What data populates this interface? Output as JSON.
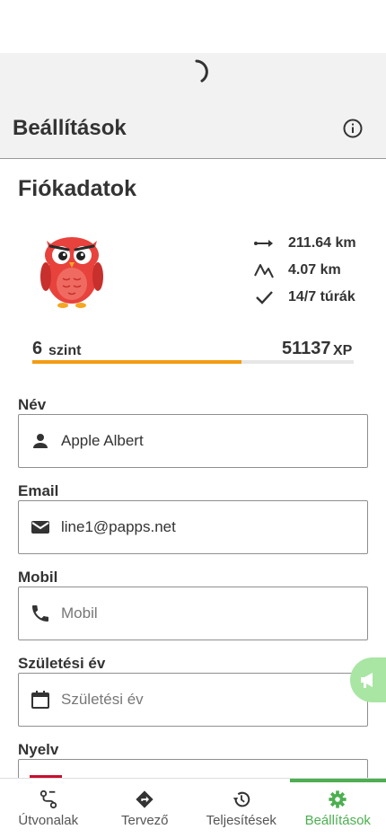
{
  "header": {
    "title": "Beállítások"
  },
  "account": {
    "section_title": "Fiókadatok",
    "stats": [
      {
        "icon": "distance-icon",
        "text": "211.64 km"
      },
      {
        "icon": "elevation-icon",
        "text": "4.07 km"
      },
      {
        "icon": "check-icon",
        "text": "14/7 túrák"
      }
    ],
    "level": {
      "value": "6",
      "unit": "szint"
    },
    "xp": {
      "value": "51137",
      "unit": "XP",
      "progress_fraction": 0.65
    }
  },
  "form": {
    "name": {
      "label": "Név",
      "value": "Apple Albert"
    },
    "email": {
      "label": "Email",
      "value": "line1@papps.net"
    },
    "mobile": {
      "label": "Mobil",
      "placeholder": "Mobil"
    },
    "birth_year": {
      "label": "Születési év",
      "placeholder": "Születési év"
    },
    "language": {
      "label": "Nyelv"
    }
  },
  "tabs": [
    {
      "label": "Útvonalak",
      "icon": "route-icon"
    },
    {
      "label": "Tervező",
      "icon": "directions-icon"
    },
    {
      "label": "Teljesítések",
      "icon": "history-icon"
    },
    {
      "label": "Beállítások",
      "icon": "gear-icon",
      "active": true
    }
  ],
  "colors": {
    "accent": "#4caf50",
    "xp_bar": "#f39c12",
    "feedback": "#a9e5a3"
  }
}
